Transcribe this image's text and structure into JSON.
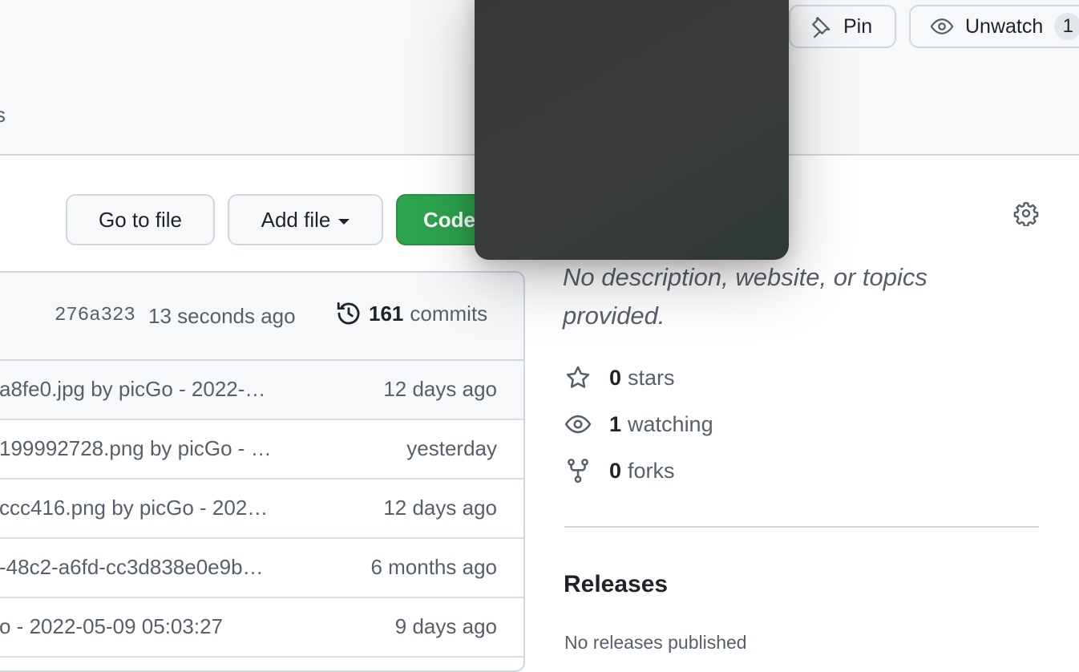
{
  "header": {
    "tab_fragment": "s",
    "pin_label": "Pin",
    "unwatch_label": "Unwatch",
    "unwatch_count": "1"
  },
  "toolbar": {
    "go_to_file": "Go to file",
    "add_file": "Add file",
    "code": "Code"
  },
  "commit_bar": {
    "sha": "276a323",
    "time": "13 seconds ago",
    "count": "161",
    "count_label": "commits"
  },
  "files": [
    {
      "message": "a8fe0.jpg by picGo - 2022-…",
      "age": "12 days ago"
    },
    {
      "message": "199992728.png by picGo - …",
      "age": "yesterday"
    },
    {
      "message": "ccc416.png by picGo - 202…",
      "age": "12 days ago"
    },
    {
      "message": "-48c2-a6fd-cc3d838e0e9b…",
      "age": "6 months ago"
    },
    {
      "message": "o - 2022-05-09 05:03:27",
      "age": "9 days ago"
    }
  ],
  "about": {
    "description": "No description, website, or topics provided.",
    "stars_count": "0",
    "stars_label": "stars",
    "watching_count": "1",
    "watching_label": "watching",
    "forks_count": "0",
    "forks_label": "forks"
  },
  "releases": {
    "title": "Releases",
    "empty": "No releases published"
  },
  "icons": {
    "pin": "pin-icon",
    "eye": "eye-icon",
    "gear": "gear-icon",
    "history": "history-icon",
    "star": "star-icon",
    "fork": "fork-icon"
  }
}
